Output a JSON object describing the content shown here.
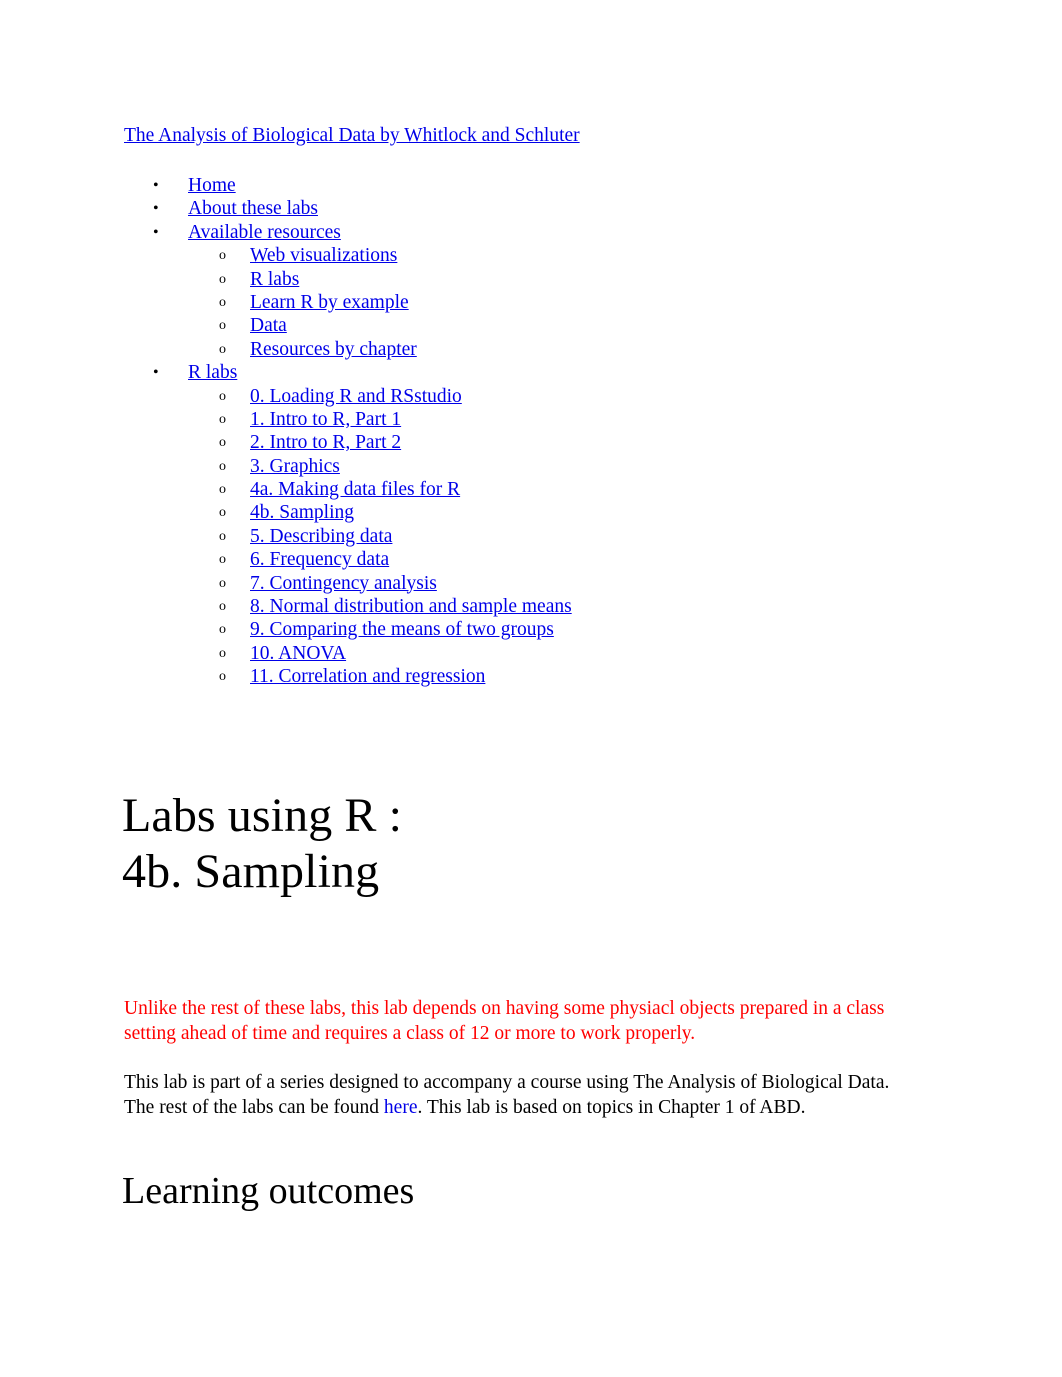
{
  "site": {
    "title": "The Analysis of Biological Data by Whitlock and Schluter"
  },
  "nav": {
    "bullet_marker": "•",
    "sub_marker": "o",
    "items": [
      {
        "level": 1,
        "label": "Home"
      },
      {
        "level": 1,
        "label": "About these labs"
      },
      {
        "level": 1,
        "label": "Available resources"
      },
      {
        "level": 2,
        "label": "Web visualizations"
      },
      {
        "level": 2,
        "label": "R labs"
      },
      {
        "level": 2,
        "label": "Learn R by example"
      },
      {
        "level": 2,
        "label": "Data"
      },
      {
        "level": 2,
        "label": "Resources by chapter"
      },
      {
        "level": 1,
        "label": "R labs"
      },
      {
        "level": 2,
        "label": "0. Loading R and RSstudio"
      },
      {
        "level": 2,
        "label": "1. Intro to R, Part 1"
      },
      {
        "level": 2,
        "label": "2. Intro to R, Part 2"
      },
      {
        "level": 2,
        "label": "3. Graphics"
      },
      {
        "level": 2,
        "label": "4a. Making data files for R"
      },
      {
        "level": 2,
        "label": "4b. Sampling"
      },
      {
        "level": 2,
        "label": "5. Describing data"
      },
      {
        "level": 2,
        "label": "6. Frequency data"
      },
      {
        "level": 2,
        "label": "7. Contingency analysis"
      },
      {
        "level": 2,
        "label": "8. Normal distribution and sample means"
      },
      {
        "level": 2,
        "label": "9. Comparing the means of two groups"
      },
      {
        "level": 2,
        "label": "10. ANOVA"
      },
      {
        "level": 2,
        "label": "11. Correlation and regression"
      }
    ]
  },
  "main": {
    "title_line1": "Labs using R :",
    "title_line2": "4b. Sampling",
    "warning": "Unlike the rest of these labs, this lab depends on having some physiacl objects prepared in a class setting ahead of time and requires a class of 12 or more to work properly.",
    "intro_part1": "This lab is part of a series designed to accompany a course using  The Analysis of Biological Data. The rest of the labs can be found ",
    "intro_link": "here",
    "intro_part2": ". This lab is based on topics in Chapter 1 of ABD.",
    "section_heading": "Learning outcomes"
  },
  "colors": {
    "link": "#0000e8",
    "warning": "#ff0000",
    "text": "#000000",
    "background": "#ffffff"
  }
}
